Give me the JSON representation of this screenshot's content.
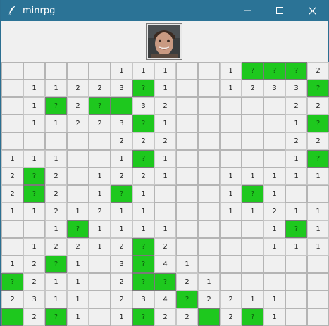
{
  "window": {
    "title": "minrpg",
    "icon": "feather-icon",
    "controls": [
      "minimize-icon",
      "maximize-icon",
      "close-icon"
    ]
  },
  "avatar": {
    "icon": "player-portrait",
    "alt": ""
  },
  "colors": {
    "titlebar": "#2b7396",
    "flag": "#1ec81e",
    "background": "#f0f0f0"
  },
  "board": {
    "rows": [
      [
        "",
        "",
        "",
        "",
        "",
        "1",
        "1",
        "1",
        "",
        "",
        "1",
        "F?",
        "F?",
        "F?",
        "2"
      ],
      [
        "",
        "1",
        "1",
        "2",
        "2",
        "3",
        "F?",
        "1",
        "",
        "",
        "1",
        "2",
        "3",
        "3",
        "F?"
      ],
      [
        "",
        "1",
        "F?",
        "2",
        "F?",
        "F",
        "3",
        "2",
        "",
        "",
        "",
        "",
        "",
        "2",
        "2"
      ],
      [
        "",
        "1",
        "1",
        "2",
        "2",
        "3",
        "F?",
        "1",
        "",
        "",
        "",
        "",
        "",
        "1",
        "F?"
      ],
      [
        "",
        "",
        "",
        "",
        "",
        "2",
        "2",
        "2",
        "",
        "",
        "",
        "",
        "",
        "2",
        "2"
      ],
      [
        "1",
        "1",
        "1",
        "",
        "",
        "1",
        "F?",
        "1",
        "",
        "",
        "",
        "",
        "",
        "1",
        "F?"
      ],
      [
        "2",
        "F?",
        "2",
        "",
        "1",
        "2",
        "2",
        "1",
        "",
        "",
        "1",
        "1",
        "1",
        "1",
        "1"
      ],
      [
        "2",
        "F?",
        "2",
        "",
        "1",
        "F?",
        "1",
        "",
        "",
        "",
        "1",
        "F?",
        "1",
        "",
        ""
      ],
      [
        "1",
        "1",
        "2",
        "1",
        "2",
        "1",
        "1",
        "",
        "",
        "",
        "1",
        "1",
        "2",
        "1",
        "1"
      ],
      [
        "",
        "",
        "1",
        "F?",
        "1",
        "1",
        "1",
        "1",
        "",
        "",
        "",
        "",
        "1",
        "F?",
        "1"
      ],
      [
        "",
        "1",
        "2",
        "2",
        "1",
        "2",
        "F?",
        "2",
        "",
        "",
        "",
        "",
        "1",
        "1",
        "1"
      ],
      [
        "1",
        "2",
        "F?",
        "1",
        "",
        "3",
        "F?",
        "4",
        "1",
        "",
        "",
        "",
        "",
        "",
        ""
      ],
      [
        "F?",
        "2",
        "1",
        "1",
        "",
        "2",
        "F?",
        "F?",
        "2",
        "1",
        "",
        "",
        "",
        "",
        ""
      ],
      [
        "2",
        "3",
        "1",
        "1",
        "",
        "2",
        "3",
        "4",
        "F?",
        "2",
        "2",
        "1",
        "1",
        "",
        ""
      ],
      [
        "F",
        "2",
        "F?",
        "1",
        "",
        "1",
        "F?",
        "2",
        "2",
        "F",
        "2",
        "F?",
        "1",
        "",
        ""
      ]
    ]
  }
}
